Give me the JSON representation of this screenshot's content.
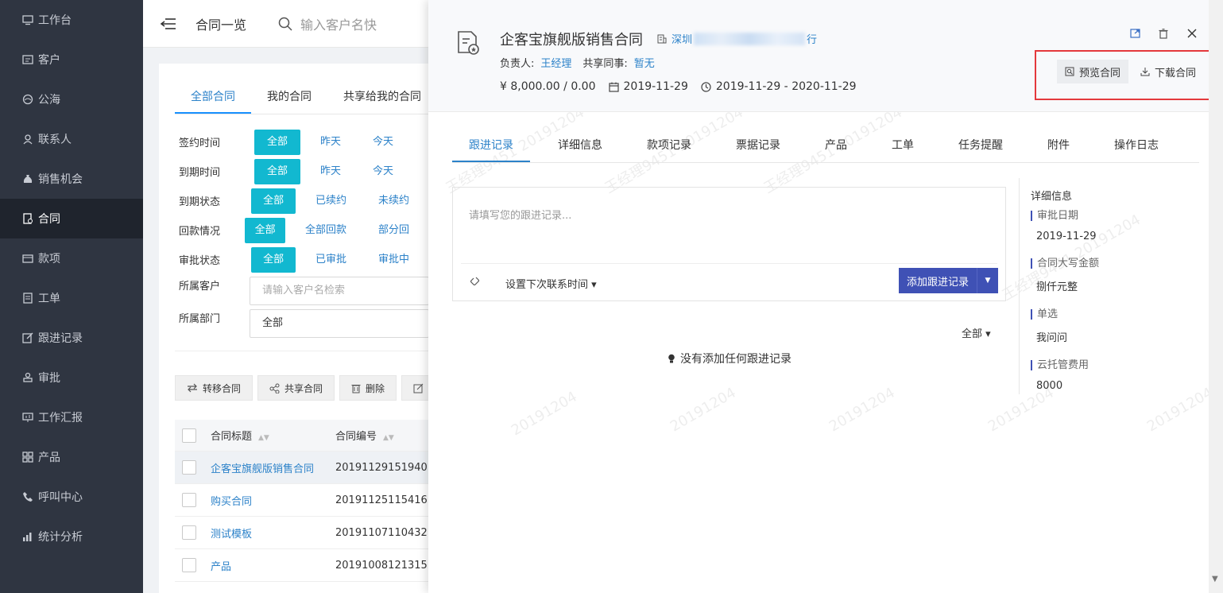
{
  "sidebar": {
    "items": [
      {
        "label": "工作台",
        "icon": "monitor-icon"
      },
      {
        "label": "客户",
        "icon": "customer-icon"
      },
      {
        "label": "公海",
        "icon": "sea-icon"
      },
      {
        "label": "联系人",
        "icon": "contact-icon"
      },
      {
        "label": "销售机会",
        "icon": "money-bag-icon"
      },
      {
        "label": "合同",
        "icon": "contract-icon",
        "active": true
      },
      {
        "label": "款项",
        "icon": "payment-icon"
      },
      {
        "label": "工单",
        "icon": "ticket-icon"
      },
      {
        "label": "跟进记录",
        "icon": "edit-icon"
      },
      {
        "label": "审批",
        "icon": "approve-icon"
      },
      {
        "label": "工作汇报",
        "icon": "report-icon"
      },
      {
        "label": "产品",
        "icon": "product-icon"
      },
      {
        "label": "呼叫中心",
        "icon": "phone-icon"
      },
      {
        "label": "统计分析",
        "icon": "chart-icon"
      }
    ]
  },
  "topbar": {
    "breadcrumb": "合同一览",
    "search_placeholder": "输入客户名快"
  },
  "list": {
    "tabs": [
      "全部合同",
      "我的合同",
      "共享给我的合同"
    ],
    "filters": [
      {
        "label": "签约时间",
        "options": [
          "全部",
          "昨天",
          "今天"
        ]
      },
      {
        "label": "到期时间",
        "options": [
          "全部",
          "昨天",
          "今天"
        ]
      },
      {
        "label": "到期状态",
        "options": [
          "全部",
          "已续约",
          "未续约"
        ]
      },
      {
        "label": "回款情况",
        "options": [
          "全部",
          "全部回款",
          "部分回"
        ]
      },
      {
        "label": "审批状态",
        "options": [
          "全部",
          "已审批",
          "审批中"
        ]
      }
    ],
    "customer_filter": {
      "label": "所属客户",
      "placeholder": "请输入客户名检索"
    },
    "dept_filter": {
      "label": "所属部门",
      "value": "全部"
    },
    "actions": [
      "转移合同",
      "共享合同",
      "删除"
    ],
    "columns": [
      "合同标题",
      "合同编号"
    ],
    "rows": [
      {
        "title": "企客宝旗舰版销售合同",
        "code": "20191129151940"
      },
      {
        "title": "购买合同",
        "code": "20191125115416"
      },
      {
        "title": "测试模板",
        "code": "20191107110432"
      },
      {
        "title": "产品",
        "code": "20191008121315"
      }
    ]
  },
  "drawer": {
    "title": "企客宝旗舰版销售合同",
    "company_prefix": "深圳",
    "company_suffix": "行",
    "owner_label": "负责人:",
    "owner": "王经理",
    "share_label": "共享同事:",
    "share_value": "暂无",
    "amount": "¥ 8,000.00 / 0.00",
    "sign_date": "2019-11-29",
    "period": "2019-11-29 - 2020-11-29",
    "preview_btn": "预览合同",
    "download_btn": "下载合同",
    "tabs": [
      "跟进记录",
      "详细信息",
      "款项记录",
      "票据记录",
      "产品",
      "工单",
      "任务提醒",
      "附件",
      "操作日志"
    ],
    "editor_placeholder": "请填写您的跟进记录...",
    "next_contact": "设置下次联系时间",
    "add_btn": "添加跟进记录",
    "filter_all": "全部",
    "empty_text": "没有添加任何跟进记录",
    "detail": {
      "title": "详细信息",
      "fields": [
        {
          "label": "审批日期",
          "value": "2019-11-29"
        },
        {
          "label": "合同大写金额",
          "value": "捌仟元整"
        },
        {
          "label": "单选",
          "value": "我问问"
        },
        {
          "label": "云托管费用",
          "value": "8000"
        }
      ]
    },
    "watermark": [
      "王经理9451 20191204",
      "20191204"
    ]
  },
  "colors": {
    "sidebar_bg": "#2f3541",
    "chip_active": "#12b8d0",
    "primary": "#3f51b5",
    "link": "#2c82c9",
    "highlight": "#e4393c"
  }
}
